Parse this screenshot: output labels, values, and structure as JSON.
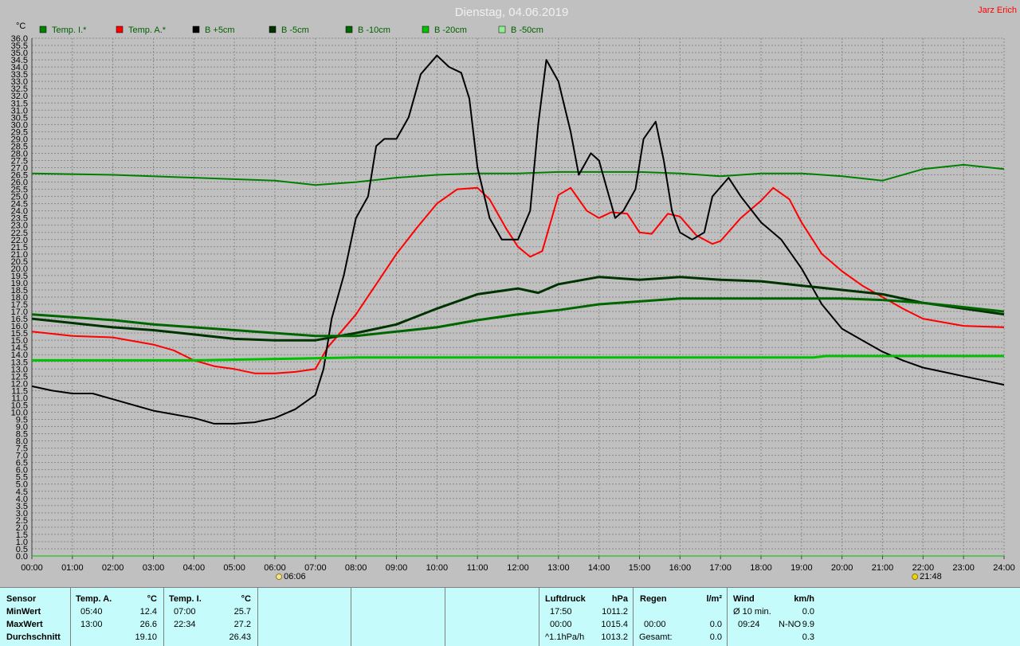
{
  "chart_data": {
    "type": "line",
    "title": "Dienstag, 04.06.2019",
    "author": "Jarz Erich",
    "ylabel": "°C",
    "ylim": [
      0,
      36
    ],
    "yticks": [
      "0.0",
      "0.5",
      "1.0",
      "1.5",
      "2.0",
      "2.5",
      "3.0",
      "3.5",
      "4.0",
      "4.5",
      "5.0",
      "5.5",
      "6.0",
      "6.5",
      "7.0",
      "7.5",
      "8.0",
      "8.5",
      "9.0",
      "9.5",
      "10.0",
      "10.5",
      "11.0",
      "11.5",
      "12.0",
      "12.5",
      "13.0",
      "13.5",
      "14.0",
      "14.5",
      "15.0",
      "15.5",
      "16.0",
      "16.5",
      "17.0",
      "17.5",
      "18.0",
      "18.5",
      "19.0",
      "19.5",
      "20.0",
      "20.5",
      "21.0",
      "21.5",
      "22.0",
      "22.5",
      "23.0",
      "23.5",
      "24.0",
      "24.5",
      "25.0",
      "25.5",
      "26.0",
      "26.5",
      "27.0",
      "27.5",
      "28.0",
      "28.5",
      "29.0",
      "29.5",
      "30.0",
      "30.5",
      "31.0",
      "31.5",
      "32.0",
      "32.5",
      "33.0",
      "33.5",
      "34.0",
      "34.5",
      "35.0",
      "35.5",
      "36.0"
    ],
    "xlim": [
      0,
      24
    ],
    "xticks": [
      "00:00",
      "01:00",
      "02:00",
      "03:00",
      "04:00",
      "05:00",
      "06:00",
      "07:00",
      "08:00",
      "09:00",
      "10:00",
      "11:00",
      "12:00",
      "13:00",
      "14:00",
      "15:00",
      "16:00",
      "17:00",
      "18:00",
      "19:00",
      "20:00",
      "21:00",
      "22:00",
      "23:00",
      "24:00"
    ],
    "grid": true,
    "legend_position": "top",
    "sunrise": {
      "time": "06:06",
      "x": 6.1
    },
    "sunset": {
      "time": "21:48",
      "x": 21.8
    },
    "series": [
      {
        "name": "Temp. I.*",
        "color": "#008000",
        "width": 2,
        "x": [
          0,
          2,
          4,
          6,
          7,
          8,
          9,
          10,
          11,
          12,
          13,
          14,
          15,
          16,
          17,
          18,
          19,
          20,
          21,
          22,
          23,
          24
        ],
        "y": [
          26.6,
          26.5,
          26.3,
          26.1,
          25.8,
          26.0,
          26.3,
          26.5,
          26.6,
          26.6,
          26.7,
          26.7,
          26.7,
          26.6,
          26.4,
          26.6,
          26.6,
          26.4,
          26.1,
          26.9,
          27.2,
          26.9
        ]
      },
      {
        "name": "Temp. A.*",
        "color": "#ff0000",
        "width": 2,
        "x": [
          0,
          1,
          2,
          3,
          3.5,
          4,
          4.5,
          5,
          5.5,
          6,
          6.5,
          7,
          7.3,
          7.7,
          8,
          8.5,
          9,
          9.5,
          10,
          10.5,
          11,
          11.3,
          11.7,
          12,
          12.3,
          12.6,
          13,
          13.3,
          13.7,
          14,
          14.3,
          14.7,
          15,
          15.3,
          15.7,
          16,
          16.4,
          16.8,
          17,
          17.5,
          18,
          18.3,
          18.7,
          19,
          19.5,
          20,
          20.5,
          21,
          21.5,
          22,
          23,
          24
        ],
        "y": [
          15.6,
          15.3,
          15.2,
          14.7,
          14.3,
          13.6,
          13.2,
          13.0,
          12.7,
          12.7,
          12.8,
          13.0,
          14.5,
          15.8,
          16.8,
          18.9,
          21.0,
          22.8,
          24.5,
          25.5,
          25.6,
          24.8,
          22.8,
          21.5,
          20.8,
          21.2,
          25.1,
          25.6,
          24.0,
          23.5,
          23.9,
          23.8,
          22.5,
          22.4,
          23.8,
          23.6,
          22.3,
          21.7,
          21.9,
          23.5,
          24.7,
          25.6,
          24.8,
          23.2,
          21.0,
          19.8,
          18.8,
          18.0,
          17.2,
          16.5,
          16.0,
          15.9
        ]
      },
      {
        "name": "B +5cm",
        "color": "#000000",
        "width": 2,
        "x": [
          0,
          0.5,
          1,
          1.5,
          2,
          3,
          4,
          4.5,
          5,
          5.5,
          6,
          6.5,
          7,
          7.2,
          7.4,
          7.7,
          8,
          8.3,
          8.5,
          8.7,
          9,
          9.3,
          9.6,
          10,
          10.3,
          10.6,
          10.8,
          11,
          11.3,
          11.6,
          12,
          12.3,
          12.5,
          12.7,
          13,
          13.3,
          13.5,
          13.8,
          14,
          14.2,
          14.4,
          14.6,
          14.9,
          15.1,
          15.4,
          15.6,
          15.8,
          16,
          16.3,
          16.6,
          16.8,
          17.2,
          17.5,
          18,
          18.5,
          19,
          19.5,
          20,
          20.5,
          21,
          21.5,
          22,
          22.5,
          23,
          23.5,
          24
        ],
        "y": [
          11.8,
          11.5,
          11.3,
          11.3,
          10.9,
          10.1,
          9.6,
          9.2,
          9.2,
          9.3,
          9.6,
          10.2,
          11.2,
          13.0,
          16.5,
          19.5,
          23.5,
          25.0,
          28.5,
          29.0,
          29.0,
          30.5,
          33.5,
          34.8,
          34.0,
          33.6,
          31.8,
          27.0,
          23.5,
          22.0,
          22.0,
          24.0,
          30.0,
          34.5,
          33.0,
          29.5,
          26.5,
          28.0,
          27.5,
          25.5,
          23.5,
          24.0,
          25.5,
          29.0,
          30.2,
          27.5,
          24.0,
          22.5,
          22.0,
          22.5,
          25.0,
          26.3,
          25.0,
          23.2,
          22.0,
          20.0,
          17.5,
          15.8,
          15.0,
          14.2,
          13.6,
          13.1,
          12.8,
          12.5,
          12.2,
          11.9
        ]
      },
      {
        "name": "B -5cm",
        "color": "#003300",
        "width": 3,
        "x": [
          0,
          1,
          2,
          3,
          4,
          5,
          6,
          7,
          8,
          9,
          10,
          11,
          12,
          12.5,
          13,
          14,
          15,
          16,
          17,
          18,
          19,
          20,
          21,
          22,
          23,
          24
        ],
        "y": [
          16.5,
          16.2,
          15.9,
          15.7,
          15.4,
          15.1,
          15.0,
          15.0,
          15.5,
          16.1,
          17.2,
          18.2,
          18.6,
          18.3,
          18.9,
          19.4,
          19.2,
          19.4,
          19.2,
          19.1,
          18.8,
          18.5,
          18.2,
          17.6,
          17.2,
          16.8
        ]
      },
      {
        "name": "B -10cm",
        "color": "#006600",
        "width": 3,
        "x": [
          0,
          1,
          2,
          3,
          4,
          5,
          6,
          7,
          8,
          9,
          10,
          11,
          12,
          13,
          14,
          15,
          16,
          17,
          18,
          19,
          20,
          21,
          22,
          23,
          24
        ],
        "y": [
          16.8,
          16.6,
          16.4,
          16.1,
          15.9,
          15.7,
          15.5,
          15.3,
          15.3,
          15.6,
          15.9,
          16.4,
          16.8,
          17.1,
          17.5,
          17.7,
          17.9,
          17.9,
          17.9,
          17.9,
          17.9,
          17.8,
          17.6,
          17.3,
          17.0
        ]
      },
      {
        "name": "B -20cm",
        "color": "#00c000",
        "width": 3,
        "x": [
          0,
          2,
          4,
          6,
          8,
          10,
          12,
          14,
          16,
          18,
          19.3,
          19.6,
          20,
          22,
          24
        ],
        "y": [
          13.6,
          13.6,
          13.6,
          13.7,
          13.8,
          13.8,
          13.8,
          13.8,
          13.8,
          13.8,
          13.8,
          13.9,
          13.9,
          13.9,
          13.9
        ]
      },
      {
        "name": "B -50cm",
        "color": "#90ee90",
        "width": 2,
        "x": [],
        "y": []
      }
    ]
  },
  "summary": {
    "sensor_header": "Sensor",
    "minwert_label": "MinWert",
    "maxwert_label": "MaxWert",
    "durchschnitt_label": "Durchschnitt",
    "temp_a": {
      "header": "Temp. A.",
      "unit": "°C",
      "min_time": "05:40",
      "min_val": "12.4",
      "max_time": "13:00",
      "max_val": "26.6",
      "avg": "19.10"
    },
    "temp_i": {
      "header": "Temp. I.",
      "unit": "°C",
      "min_time": "07:00",
      "min_val": "25.7",
      "max_time": "22:34",
      "max_val": "27.2",
      "avg": "26.43"
    },
    "luftdruck": {
      "header": "Luftdruck",
      "unit": "hPa",
      "min_time": "17:50",
      "min_val": "1011.2",
      "max_time": "00:00",
      "max_val": "1015.4",
      "trend_label": "^1.1hPa/h",
      "current": "1013.2"
    },
    "regen": {
      "header": "Regen",
      "unit": "l/m²",
      "max_time": "00:00",
      "max_val": "0.0",
      "total_label": "Gesamt:",
      "total": "0.0"
    },
    "wind": {
      "header": "Wind",
      "unit": "km/h",
      "avg_label": "Ø 10 min.",
      "avg_val": "0.0",
      "max_time": "09:24",
      "max_dir": "N-NO",
      "max_val": "9.9",
      "current": "0.3"
    }
  }
}
